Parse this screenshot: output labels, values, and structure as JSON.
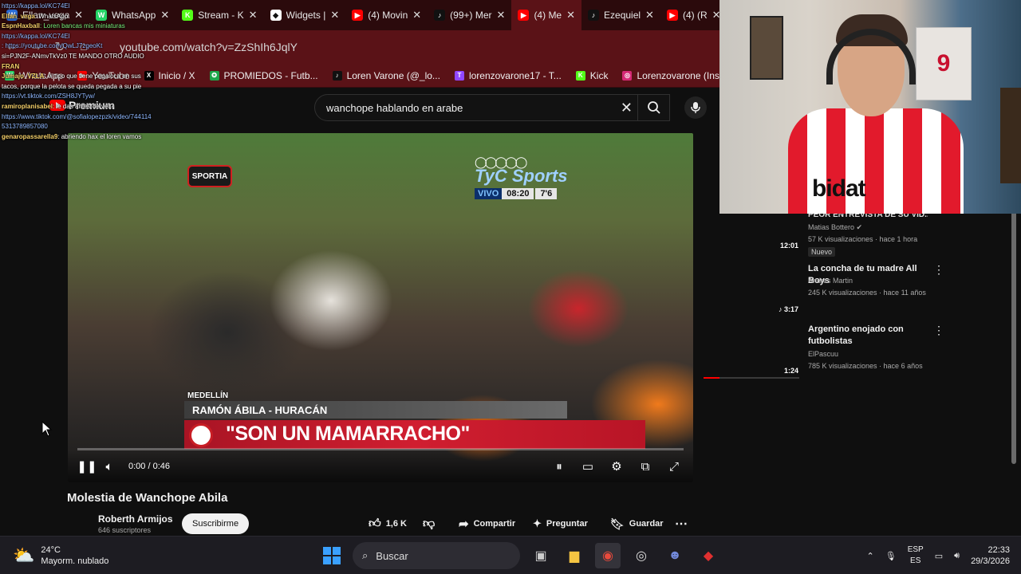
{
  "browser": {
    "tabs": [
      {
        "label": "Ellan_vega",
        "color": "#2b6cd6",
        "glyph": "W"
      },
      {
        "label": "WhatsApp",
        "color": "#25d366",
        "glyph": "W"
      },
      {
        "label": "Stream - K",
        "color": "#53fc18",
        "glyph": "K"
      },
      {
        "label": "Widgets |",
        "color": "#ffffff",
        "glyph": "◆"
      },
      {
        "label": "(4) Movin",
        "color": "#ff0000",
        "glyph": "▶"
      },
      {
        "label": "(99+) Mer",
        "color": "#111111",
        "glyph": "♪"
      },
      {
        "label": "(4) Me",
        "color": "#ff0000",
        "glyph": "▶"
      },
      {
        "label": "Ezequiel",
        "color": "#111111",
        "glyph": "♪"
      },
      {
        "label": "(4) (R",
        "color": "#ff0000",
        "glyph": "▶"
      }
    ],
    "url": "youtube.com/watch?v=ZzShIh6JqlY",
    "bookmarks": [
      {
        "label": "WhatsApp",
        "color": "#25d366",
        "glyph": "W"
      },
      {
        "label": "YouTube",
        "color": "#ff0000",
        "glyph": "▶"
      },
      {
        "label": "Inicio / X",
        "color": "#000000",
        "glyph": "X"
      },
      {
        "label": "PROMIEDOS - Futb...",
        "color": "#1fa64b",
        "glyph": "✪"
      },
      {
        "label": "Loren Varone (@_lo...",
        "color": "#111111",
        "glyph": "♪"
      },
      {
        "label": "lorenzovarone17 - T...",
        "color": "#9146ff",
        "glyph": "T"
      },
      {
        "label": "Kick",
        "color": "#53fc18",
        "glyph": "K"
      },
      {
        "label": "Lorenzovarone (Inst...",
        "color": "#d62976",
        "glyph": "◎"
      }
    ]
  },
  "youtube": {
    "logo_text": "Premium",
    "search_value": "wanchope hablando en arabe",
    "video": {
      "title": "Molestia de Wanchope Abila",
      "channel_logo": "SPORTIA",
      "broadcaster": "TyC Sports",
      "live_label": "VIVO",
      "live_time": "08:20",
      "live_score": "7'6",
      "location": "MEDELLÍN",
      "lower_third_name": "RAMÓN ÁBILA - HURACÁN",
      "quote": "\"SON UN MAMARRACHO\"",
      "time": "0:00 / 0:46",
      "progress": 0.0
    },
    "channel": {
      "name": "Roberth Armijos",
      "subs": "646 suscriptores",
      "subscribe": "Suscribirme"
    },
    "actions": {
      "likes": "1,6 K",
      "share": "Compartir",
      "ask": "Preguntar",
      "save": "Guardar"
    },
    "recommendations": [
      {
        "title": "PEOR ENTREVISTA DE SU VID...",
        "channel": "Matias Bottero",
        "meta": "57 K visualizaciones · hace 1 hora",
        "duration": "12:01",
        "badge": "Nuevo"
      },
      {
        "title": "La concha de tu madre All Boys",
        "channel": "Andres Martin",
        "meta": "245 K visualizaciones · hace 11 años",
        "duration": "3:17"
      },
      {
        "title": "Argentino enojado con futbolistas",
        "channel": "ElPascuu",
        "meta": "785 K visualizaciones · hace 6 años",
        "duration": "1:24"
      }
    ]
  },
  "chat": [
    {
      "user": "",
      "text": "https://kappa.lol/KC74El",
      "color": "#8fb8ff"
    },
    {
      "user": "Ellan_vega",
      "text": ": WhatsApp",
      "color": "#ffffff"
    },
    {
      "user": "EspnHaxball",
      "text": ": Loren bancas mis miniaturas",
      "color": "#7cf07c"
    },
    {
      "user": "",
      "text": "https://kappa.lol/KC74El",
      "color": "#8fb8ff"
    },
    {
      "user": "",
      "text": ": https://youtube.com/QwLJ7zgeoKt",
      "color": "#8fb8ff"
    },
    {
      "user": "",
      "text": "si=PJN2F-ANmvTkVz0 TE MANDO OTRO AUDIO",
      "color": "#ffffff"
    },
    {
      "user": "FRAN",
      "text": "",
      "color": "#ffffff"
    },
    {
      "user": "Jumajo_VZLA",
      "text": ": el tipo que tiene pegaloca en sus",
      "color": "#ffffff"
    },
    {
      "user": "",
      "text": "tacos, porque la pelota se queda pegada a su pie",
      "color": "#ffffff"
    },
    {
      "user": "",
      "text": "https://vt.tiktok.com/ZSH8JYTyw/",
      "color": "#8fb8ff"
    },
    {
      "user": "ramiroplanisabel",
      "text": ": le das antes de ver?",
      "color": "#ffffff"
    },
    {
      "user": "",
      "text": "https://www.tiktok.com/@sofialopezpzk/video/744114",
      "color": "#8fb8ff"
    },
    {
      "user": "",
      "text": "5313789857080",
      "color": "#8fb8ff"
    },
    {
      "user": "genaropassarella9",
      "text": ": abriendo hax el loren vamos",
      "color": "#ffffff"
    }
  ],
  "webcam": {
    "shirt_text": "bidat",
    "wall_jersey_number": "9"
  },
  "taskbar": {
    "temp": "24°C",
    "weather": "Mayorm. nublado",
    "search": "Buscar",
    "lang1": "ESP",
    "lang2": "ES",
    "time": "22:33",
    "date": "29/3/2026"
  }
}
